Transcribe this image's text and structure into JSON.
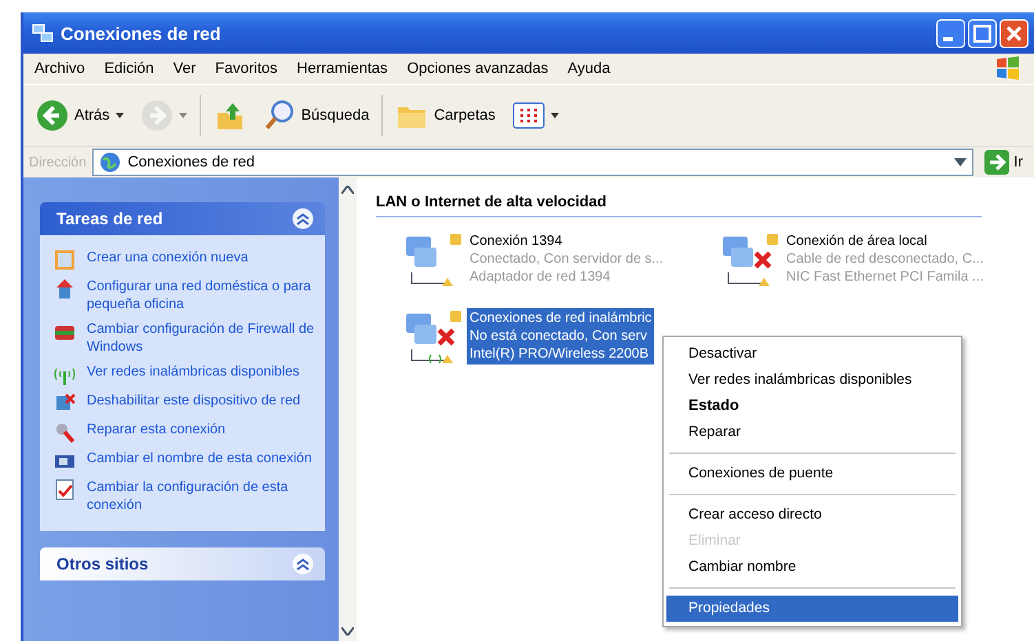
{
  "window": {
    "title": "Conexiones de red"
  },
  "menu_bar": [
    "Archivo",
    "Edición",
    "Ver",
    "Favoritos",
    "Herramientas",
    "Opciones avanzadas",
    "Ayuda"
  ],
  "toolbar": [
    {
      "kind": "back",
      "label": "Atrás",
      "disabled": false
    },
    {
      "kind": "forward",
      "disabled": true
    },
    {
      "kind": "up",
      "disabled": false
    },
    {
      "kind": "search",
      "label": "Búsqueda",
      "disabled": false
    },
    {
      "kind": "folders",
      "label": "Carpetas",
      "disabled": false
    },
    {
      "kind": "views",
      "disabled": false
    }
  ],
  "address_bar": {
    "label": "Dirección",
    "value": "Conexiones de red",
    "go": "Ir"
  },
  "sidebar": {
    "panels": [
      {
        "title": "Tareas de red",
        "expanded": true,
        "items": [
          {
            "kind": "new",
            "label": "Crear una conexión nueva"
          },
          {
            "kind": "home",
            "label": "Configurar una red doméstica o para pequeña oficina"
          },
          {
            "kind": "firewall",
            "label": "Cambiar configuración de Firewall de Windows"
          },
          {
            "kind": "wireless",
            "label": "Ver redes inalámbricas disponibles"
          },
          {
            "kind": "disable",
            "label": "Deshabilitar este dispositivo de red"
          },
          {
            "kind": "repair",
            "label": "Reparar esta conexión"
          },
          {
            "kind": "rename",
            "label": "Cambiar el nombre de esta conexión"
          },
          {
            "kind": "settings",
            "label": "Cambiar la configuración de esta conexión"
          }
        ]
      },
      {
        "title": "Otros sitios",
        "expanded": true
      }
    ]
  },
  "content": {
    "group_title": "LAN o Internet de alta velocidad",
    "connections": [
      {
        "name": "Conexión 1394",
        "status": "Conectado, Con servidor de s...",
        "device": "Adaptador de red 1394",
        "connected": true,
        "wireless": false,
        "selected": false
      },
      {
        "name": "Conexión de área local",
        "status": "Cable de red desconectado, C...",
        "device": "NIC Fast Ethernet PCI Famila ...",
        "connected": false,
        "wireless": false,
        "selected": false
      },
      {
        "name": "Conexiones de red inalámbric",
        "status": "No está conectado, Con serv",
        "device": "Intel(R) PRO/Wireless 2200B",
        "connected": false,
        "wireless": true,
        "selected": true
      }
    ]
  },
  "context_menu": [
    {
      "kind": "item",
      "label": "Desactivar",
      "default": false,
      "disabled": false,
      "selected": false
    },
    {
      "kind": "item",
      "label": "Ver redes inalámbricas disponibles",
      "default": false,
      "disabled": false,
      "selected": false
    },
    {
      "kind": "item",
      "label": "Estado",
      "default": true,
      "disabled": false,
      "selected": false
    },
    {
      "kind": "item",
      "label": "Reparar",
      "default": false,
      "disabled": false,
      "selected": false
    },
    {
      "kind": "separator"
    },
    {
      "kind": "item",
      "label": "Conexiones de puente",
      "default": false,
      "disabled": false,
      "selected": false
    },
    {
      "kind": "separator"
    },
    {
      "kind": "item",
      "label": "Crear acceso directo",
      "default": false,
      "disabled": false,
      "selected": false
    },
    {
      "kind": "item",
      "label": "Eliminar",
      "default": false,
      "disabled": true,
      "selected": false
    },
    {
      "kind": "item",
      "label": "Cambiar nombre",
      "default": false,
      "disabled": false,
      "selected": false
    },
    {
      "kind": "separator"
    },
    {
      "kind": "item",
      "label": "Propiedades",
      "default": false,
      "disabled": false,
      "selected": true
    }
  ]
}
